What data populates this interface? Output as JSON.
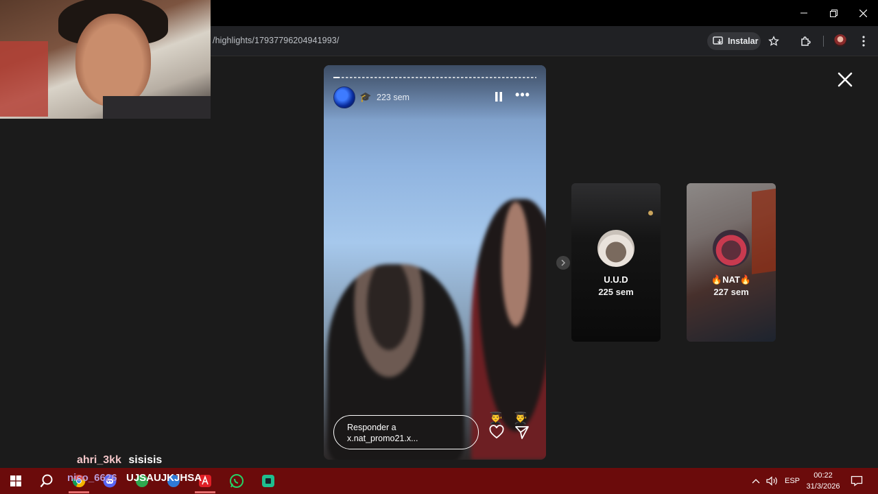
{
  "browser": {
    "url": "/highlights/17937796204941993/",
    "install_label": "Instalar"
  },
  "story": {
    "time_label": "223 sem",
    "cap_emoji": "🎓",
    "more_label": "•••",
    "reply_line1": "Responder a",
    "reply_line2": "x.nat_promo21.x...",
    "reaction_emojis": [
      "👨‍🎓",
      "👨‍🎓"
    ],
    "progress_fraction": 0.03
  },
  "highlights": [
    {
      "name": "U.U.D",
      "time": "225 sem"
    },
    {
      "name": "🔥NAT🔥",
      "time": "227 sem"
    }
  ],
  "chat": {
    "user": "ahri_3kk",
    "message": "sisisis"
  },
  "taskbar_overlay": {
    "left_text": "nico_6626",
    "right_text": "UJSAUJKJHSA"
  },
  "tray": {
    "language": "ESP",
    "time": "00:22",
    "date": "31/3/2026"
  },
  "colors": {
    "taskbar": "#6b0b0b",
    "page_bg": "#1b1b1b",
    "chat_user": "#f4c7c9"
  }
}
